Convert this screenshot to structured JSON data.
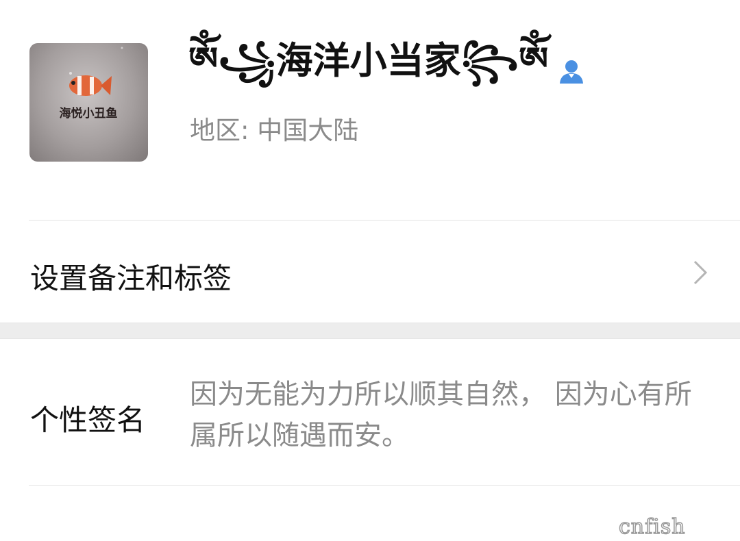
{
  "profile": {
    "nickname": "ༀ꧁海洋小当家꧂ༀ",
    "region_label": "地区:",
    "region_value": "中国大陆",
    "avatar_text": "海悦小丑鱼"
  },
  "remark": {
    "label": "设置备注和标签"
  },
  "signature": {
    "label": "个性签名",
    "text": "因为无能为力所以顺其自然， 因为心有所属所以随遇而安。"
  },
  "watermark": {
    "text": "cnfish"
  },
  "colors": {
    "text_primary": "#111111",
    "text_secondary": "#8a8a8a",
    "friend_icon": "#4a90e2",
    "divider": "#e4e4e4",
    "section_gap": "#ededed"
  },
  "icons": {
    "friend": "person-icon",
    "chevron": "chevron-right-icon"
  }
}
